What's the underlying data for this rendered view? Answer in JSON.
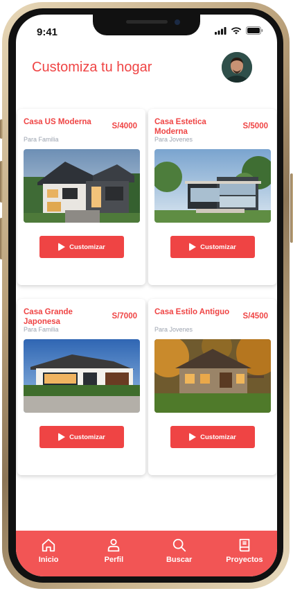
{
  "status_bar": {
    "time": "9:41"
  },
  "header": {
    "title": "Customiza tu hogar"
  },
  "colors": {
    "accent": "#ef4444",
    "nav_bg": "#f25555"
  },
  "cards": [
    {
      "title": "Casa US Moderna",
      "price": "S/4000",
      "subtitle": "Para Familia",
      "button": "Customizar",
      "image": "modern-house-photo"
    },
    {
      "title": "Casa Estetica Moderna",
      "price": "S/5000",
      "subtitle": "Para Jovenes",
      "button": "Customizar",
      "image": "glass-house-photo"
    },
    {
      "title": "Casa Grande Japonesa",
      "price": "S/7000",
      "subtitle": "Para Familia",
      "button": "Customizar",
      "image": "japanese-house-photo"
    },
    {
      "title": "Casa Estilo Antiguo",
      "price": "S/4500",
      "subtitle": "Para Jovenes",
      "button": "Customizar",
      "image": "stone-cottage-photo"
    }
  ],
  "nav": [
    {
      "label": "Inicio",
      "icon": "home-icon"
    },
    {
      "label": "Perfil",
      "icon": "user-icon"
    },
    {
      "label": "Buscar",
      "icon": "search-icon"
    },
    {
      "label": "Proyectos",
      "icon": "book-icon"
    }
  ]
}
